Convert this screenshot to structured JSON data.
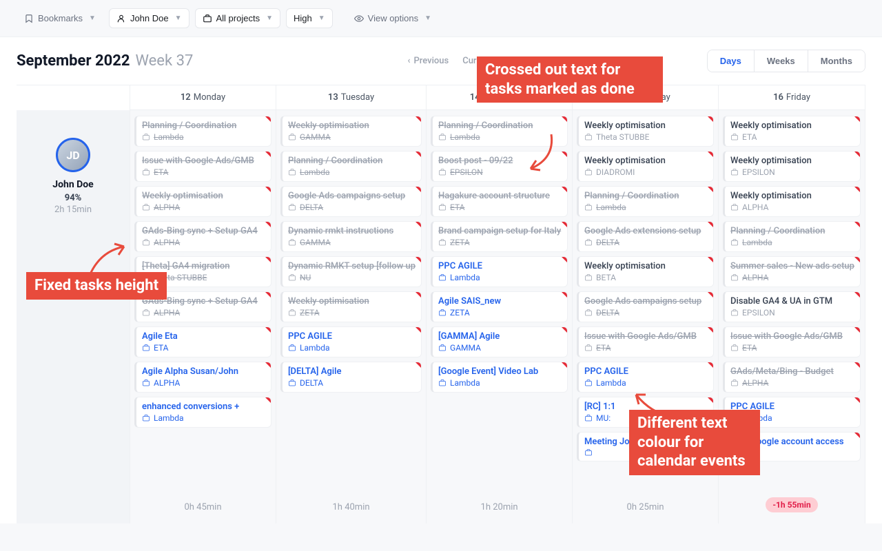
{
  "toolbar": {
    "bookmarks": "Bookmarks",
    "user": "John Doe",
    "projects": "All projects",
    "priority": "High",
    "view_options": "View options"
  },
  "header": {
    "month": "September 2022",
    "week": "Week 37",
    "previous": "Previous",
    "current": "Current",
    "days": "Days",
    "weeks": "Weeks",
    "months": "Months"
  },
  "user": {
    "name": "John Doe",
    "pct": "94%",
    "time": "2h 15min",
    "initials": "JD"
  },
  "days": [
    {
      "num": "12",
      "name": "Monday",
      "total": "0h 45min",
      "tasks": [
        {
          "t": "Planning / Coordination",
          "p": "Lambda",
          "s": "done"
        },
        {
          "t": "Issue with Google Ads/GMB",
          "p": "ETA",
          "s": "done"
        },
        {
          "t": "Weekly optimisation",
          "p": "ALPHA",
          "s": "done"
        },
        {
          "t": "GAds-Bing sync + Setup GA4",
          "p": "ALPHA",
          "s": "done"
        },
        {
          "t": "[Theta] GA4 migration",
          "p": "Theta STUBBE",
          "s": "done"
        },
        {
          "t": "GAds-Bing sync + Setup GA4",
          "p": "ALPHA",
          "s": "done"
        },
        {
          "t": "Agile Eta",
          "p": "ETA",
          "s": "event"
        },
        {
          "t": "Agile Alpha Susan/John",
          "p": "ALPHA",
          "s": "event"
        },
        {
          "t": "enhanced conversions +",
          "p": "Lambda",
          "s": "event"
        }
      ]
    },
    {
      "num": "13",
      "name": "Tuesday",
      "total": "1h 40min",
      "tasks": [
        {
          "t": "Weekly optimisation",
          "p": "GAMMA",
          "s": "done"
        },
        {
          "t": "Planning / Coordination",
          "p": "Lambda",
          "s": "done"
        },
        {
          "t": "Google Ads campaigns setup",
          "p": "DELTA",
          "s": "done"
        },
        {
          "t": "Dynamic rmkt instructions",
          "p": "GAMMA",
          "s": "done"
        },
        {
          "t": "Dynamic RMKT setup [follow up",
          "p": "NU",
          "s": "done"
        },
        {
          "t": "Weekly optimisation",
          "p": "ZETA",
          "s": "done"
        },
        {
          "t": "PPC AGILE",
          "p": "Lambda",
          "s": "event"
        },
        {
          "t": "[DELTA] Agile",
          "p": "DELTA",
          "s": "event"
        }
      ]
    },
    {
      "num": "14",
      "name": "Wednesday",
      "total": "1h 20min",
      "tasks": [
        {
          "t": "Planning / Coordination",
          "p": "Lambda",
          "s": "done"
        },
        {
          "t": "Boost post - 09/22",
          "p": "EPSILON",
          "s": "done"
        },
        {
          "t": "Hagakure account structure",
          "p": "ETA",
          "s": "done"
        },
        {
          "t": "Brand campaign setup for Italy",
          "p": "ZETA",
          "s": "done"
        },
        {
          "t": "PPC AGILE",
          "p": "Lambda",
          "s": "event"
        },
        {
          "t": "Agile SAIS_new",
          "p": "ZETA",
          "s": "event"
        },
        {
          "t": "[GAMMA] Agile",
          "p": "GAMMA",
          "s": "event"
        },
        {
          "t": "[Google Event] Video Lab",
          "p": "Lambda",
          "s": "event"
        }
      ]
    },
    {
      "num": "15",
      "name": "Thursday",
      "total": "0h 25min",
      "tasks": [
        {
          "t": "Weekly optimisation",
          "p": "Theta STUBBE",
          "s": "normal"
        },
        {
          "t": "Weekly optimisation",
          "p": "DIADROMI",
          "s": "normal"
        },
        {
          "t": "Planning / Coordination",
          "p": "Lambda",
          "s": "done"
        },
        {
          "t": "Google Ads extensions setup",
          "p": "DELTA",
          "s": "done"
        },
        {
          "t": "Weekly optimisation",
          "p": "BETA",
          "s": "normal"
        },
        {
          "t": "Google Ads campaigns setup",
          "p": "DELTA",
          "s": "done"
        },
        {
          "t": "Issue with Google Ads/GMB",
          "p": "ETA",
          "s": "done"
        },
        {
          "t": "PPC AGILE",
          "p": "Lambda",
          "s": "event"
        },
        {
          "t": "[RC] 1:1",
          "p": "MU:",
          "s": "event"
        },
        {
          "t": "Meeting John",
          "p": "",
          "s": "event"
        }
      ]
    },
    {
      "num": "16",
      "name": "Friday",
      "total_pill": "-1h 55min",
      "tasks": [
        {
          "t": "Weekly optimisation",
          "p": "ETA",
          "s": "normal"
        },
        {
          "t": "Weekly optimisation",
          "p": "EPSILON",
          "s": "normal"
        },
        {
          "t": "Weekly optimisation",
          "p": "ALPHA",
          "s": "normal"
        },
        {
          "t": "Planning / Coordination",
          "p": "Lambda",
          "s": "done"
        },
        {
          "t": "Summer sales - New ads setup",
          "p": "ALPHA",
          "s": "done"
        },
        {
          "t": "Disable GA4 & UA in GTM",
          "p": "EPSILON",
          "s": "normal"
        },
        {
          "t": "Issue with Google Ads/GMB",
          "p": "ETA",
          "s": "done"
        },
        {
          "t": "GAds/Meta/Bing - Budget",
          "p": "ALPHA",
          "s": "done"
        },
        {
          "t": "PPC AGILE",
          "p": "Lambda",
          "s": "event"
        },
        {
          "t": "[Eta] Google account access",
          "p": "",
          "s": "event"
        }
      ]
    }
  ],
  "annotations": {
    "crossed": "Crossed out text for tasks marked as done",
    "fixed": "Fixed tasks height",
    "colour": "Different text colour for calendar events"
  }
}
